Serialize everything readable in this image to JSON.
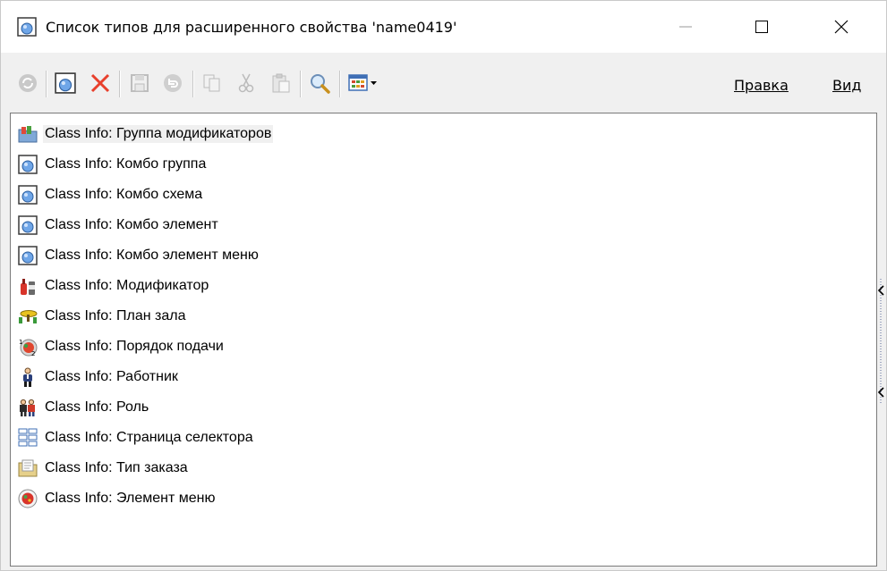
{
  "window": {
    "title": "Список типов для расширенного свойства 'name0419'",
    "title_icon": "drop-node-icon",
    "controls": [
      "minimize",
      "maximize",
      "close"
    ]
  },
  "toolbar": {
    "buttons": [
      {
        "name": "refresh-button",
        "icon": "refresh-icon",
        "enabled": false
      },
      {
        "name": "new-button",
        "icon": "new-icon",
        "enabled": true
      },
      {
        "name": "delete-button",
        "icon": "delete-icon",
        "enabled": true
      },
      {
        "name": "save-button",
        "icon": "save-icon",
        "enabled": false
      },
      {
        "name": "undo-button",
        "icon": "undo-icon",
        "enabled": false
      },
      {
        "name": "copy-button",
        "icon": "copy-icon",
        "enabled": false
      },
      {
        "name": "cut-button",
        "icon": "scissors-icon",
        "enabled": false
      },
      {
        "name": "paste-button",
        "icon": "paste-icon",
        "enabled": false
      },
      {
        "name": "search-button",
        "icon": "magnifier-icon",
        "enabled": true
      },
      {
        "name": "view-dropdown",
        "icon": "grid-dropdown-icon",
        "enabled": true
      }
    ],
    "menu": {
      "edit": "Правка",
      "view": "Вид"
    }
  },
  "list": {
    "items": [
      {
        "label": "Class Info: Группа модификаторов",
        "icon": "folder-group-icon"
      },
      {
        "label": "Class Info: Комбо группа",
        "icon": "drop-node-icon"
      },
      {
        "label": "Class Info: Комбо схема",
        "icon": "drop-node-icon"
      },
      {
        "label": "Class Info: Комбо элемент",
        "icon": "drop-node-icon"
      },
      {
        "label": "Class Info: Комбо элемент меню",
        "icon": "drop-node-icon"
      },
      {
        "label": "Class Info: Модификатор",
        "icon": "bottles-icon"
      },
      {
        "label": "Class Info: План зала",
        "icon": "table-icon"
      },
      {
        "label": "Class Info: Порядок подачи",
        "icon": "course-icon"
      },
      {
        "label": "Class Info: Работник",
        "icon": "person-icon"
      },
      {
        "label": "Class Info: Роль",
        "icon": "people-icon"
      },
      {
        "label": "Class Info: Страница селектора",
        "icon": "grid-page-icon"
      },
      {
        "label": "Class Info: Тип заказа",
        "icon": "order-folder-icon"
      },
      {
        "label": "Class Info: Элемент меню",
        "icon": "menu-dish-icon"
      }
    ],
    "selected_index": 0
  }
}
